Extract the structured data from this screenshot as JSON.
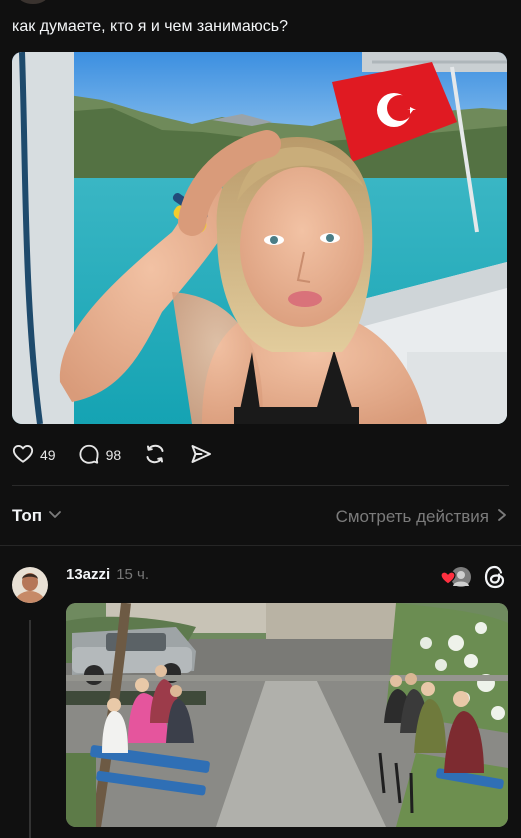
{
  "post": {
    "text": "как думаете, кто я и чем занимаюсь?",
    "image": "selfie-on-boat-with-turkish-flag",
    "likes": "49",
    "replies": "98"
  },
  "actions": {
    "like_icon": "heart-icon",
    "reply_icon": "comment-icon",
    "repost_icon": "repost-icon",
    "share_icon": "send-icon"
  },
  "sort": {
    "label": "Топ",
    "activity_link": "Смотреть действия"
  },
  "reply": {
    "username": "13azzi",
    "time": "15 ч.",
    "image": "elderly-women-on-benches"
  },
  "colors": {
    "background": "#101010",
    "text": "#f3f5f7",
    "muted": "#7b7b7b",
    "like_red": "#ff3040"
  }
}
